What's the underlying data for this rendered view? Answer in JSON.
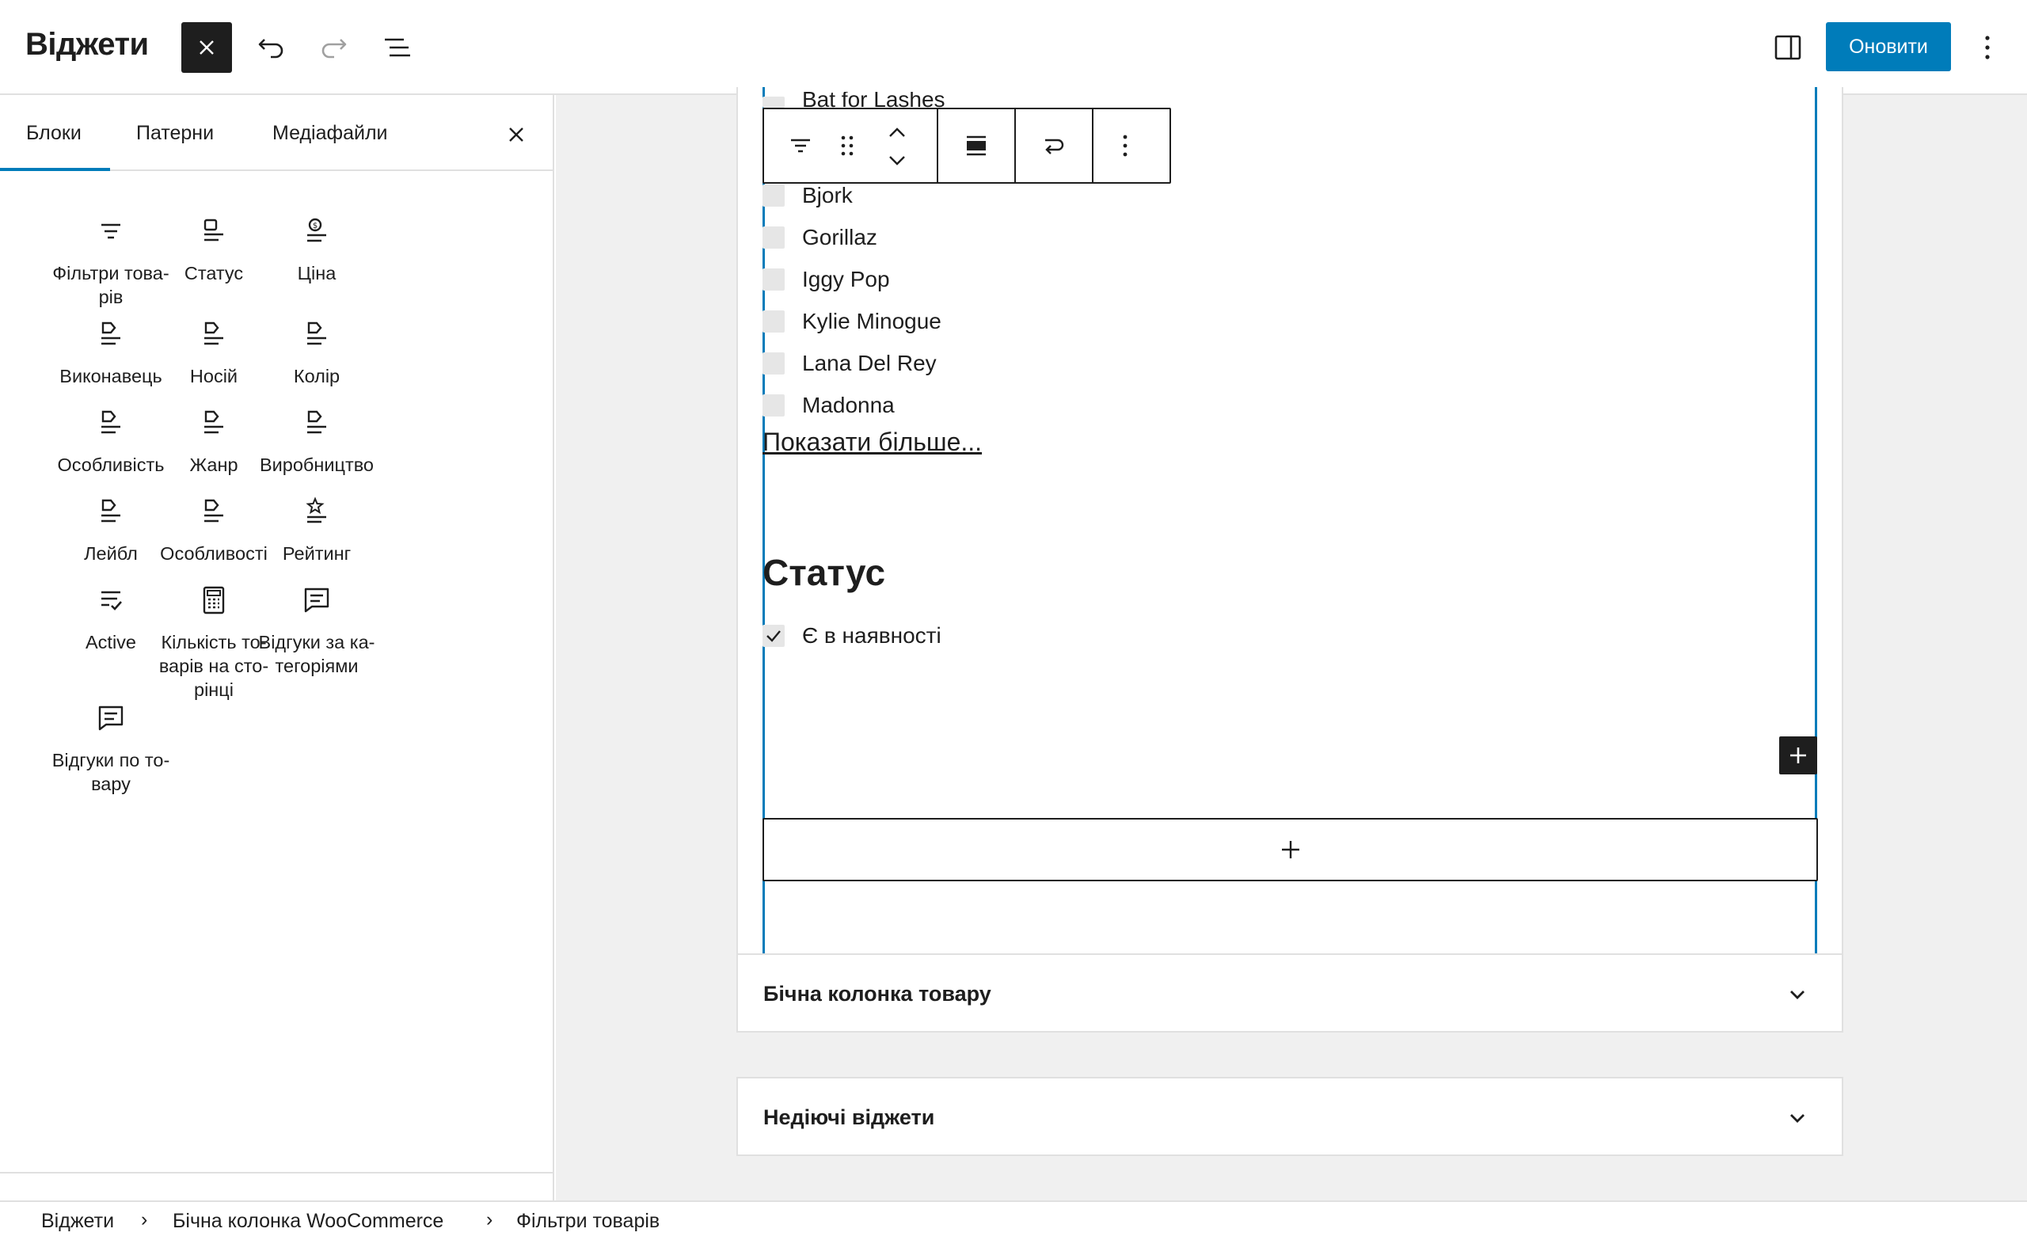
{
  "header": {
    "title": "Віджети",
    "update_label": "Оновити"
  },
  "inserter": {
    "tabs": [
      "Блоки",
      "Патерни",
      "Медіафайли"
    ],
    "blocks": [
      {
        "label": "Фільтри това-\nрів",
        "icon": "filter-icon"
      },
      {
        "label": "Статус",
        "icon": "status-icon"
      },
      {
        "label": "Ціна",
        "icon": "price-icon"
      },
      {
        "label": "Виконавець",
        "icon": "attribute-icon"
      },
      {
        "label": "Носій",
        "icon": "attribute-icon"
      },
      {
        "label": "Колір",
        "icon": "attribute-icon"
      },
      {
        "label": "Особливість",
        "icon": "attribute-icon"
      },
      {
        "label": "Жанр",
        "icon": "attribute-icon"
      },
      {
        "label": "Виробництво",
        "icon": "attribute-icon"
      },
      {
        "label": "Лейбл",
        "icon": "attribute-icon"
      },
      {
        "label": "Особливості",
        "icon": "attribute-icon"
      },
      {
        "label": "Рейтинг",
        "icon": "rating-icon"
      },
      {
        "label": "Active",
        "icon": "active-filters-icon"
      },
      {
        "label": "Кількість то-\nварів на сто-\nрінці",
        "icon": "calculator-icon"
      },
      {
        "label": "Відгуки за ка-\nтегоріями",
        "icon": "review-icon"
      },
      {
        "label": "Відгуки по то-\nвару",
        "icon": "review-icon"
      }
    ]
  },
  "editor": {
    "partial_top_option": "Bat for Lashes",
    "options": [
      {
        "label": "Bjork",
        "checked": false
      },
      {
        "label": "Gorillaz",
        "checked": false
      },
      {
        "label": "Iggy Pop",
        "checked": false
      },
      {
        "label": "Kylie Minogue",
        "checked": false
      },
      {
        "label": "Lana Del Rey",
        "checked": false
      },
      {
        "label": "Madonna",
        "checked": false
      }
    ],
    "show_more": "Показати більше...",
    "status_heading": "Статус",
    "status_option": {
      "label": "Є в наявності",
      "checked": true
    }
  },
  "panels": [
    {
      "title": "Бічна колонка товару"
    },
    {
      "title": "Недіючі віджети"
    }
  ],
  "breadcrumb": [
    "Віджети",
    "Бічна колонка WooCommerce",
    "Фільтри товарів"
  ],
  "colors": {
    "accent": "#007cba",
    "text": "#1e1e1e",
    "canvas": "#f0f0f0"
  }
}
